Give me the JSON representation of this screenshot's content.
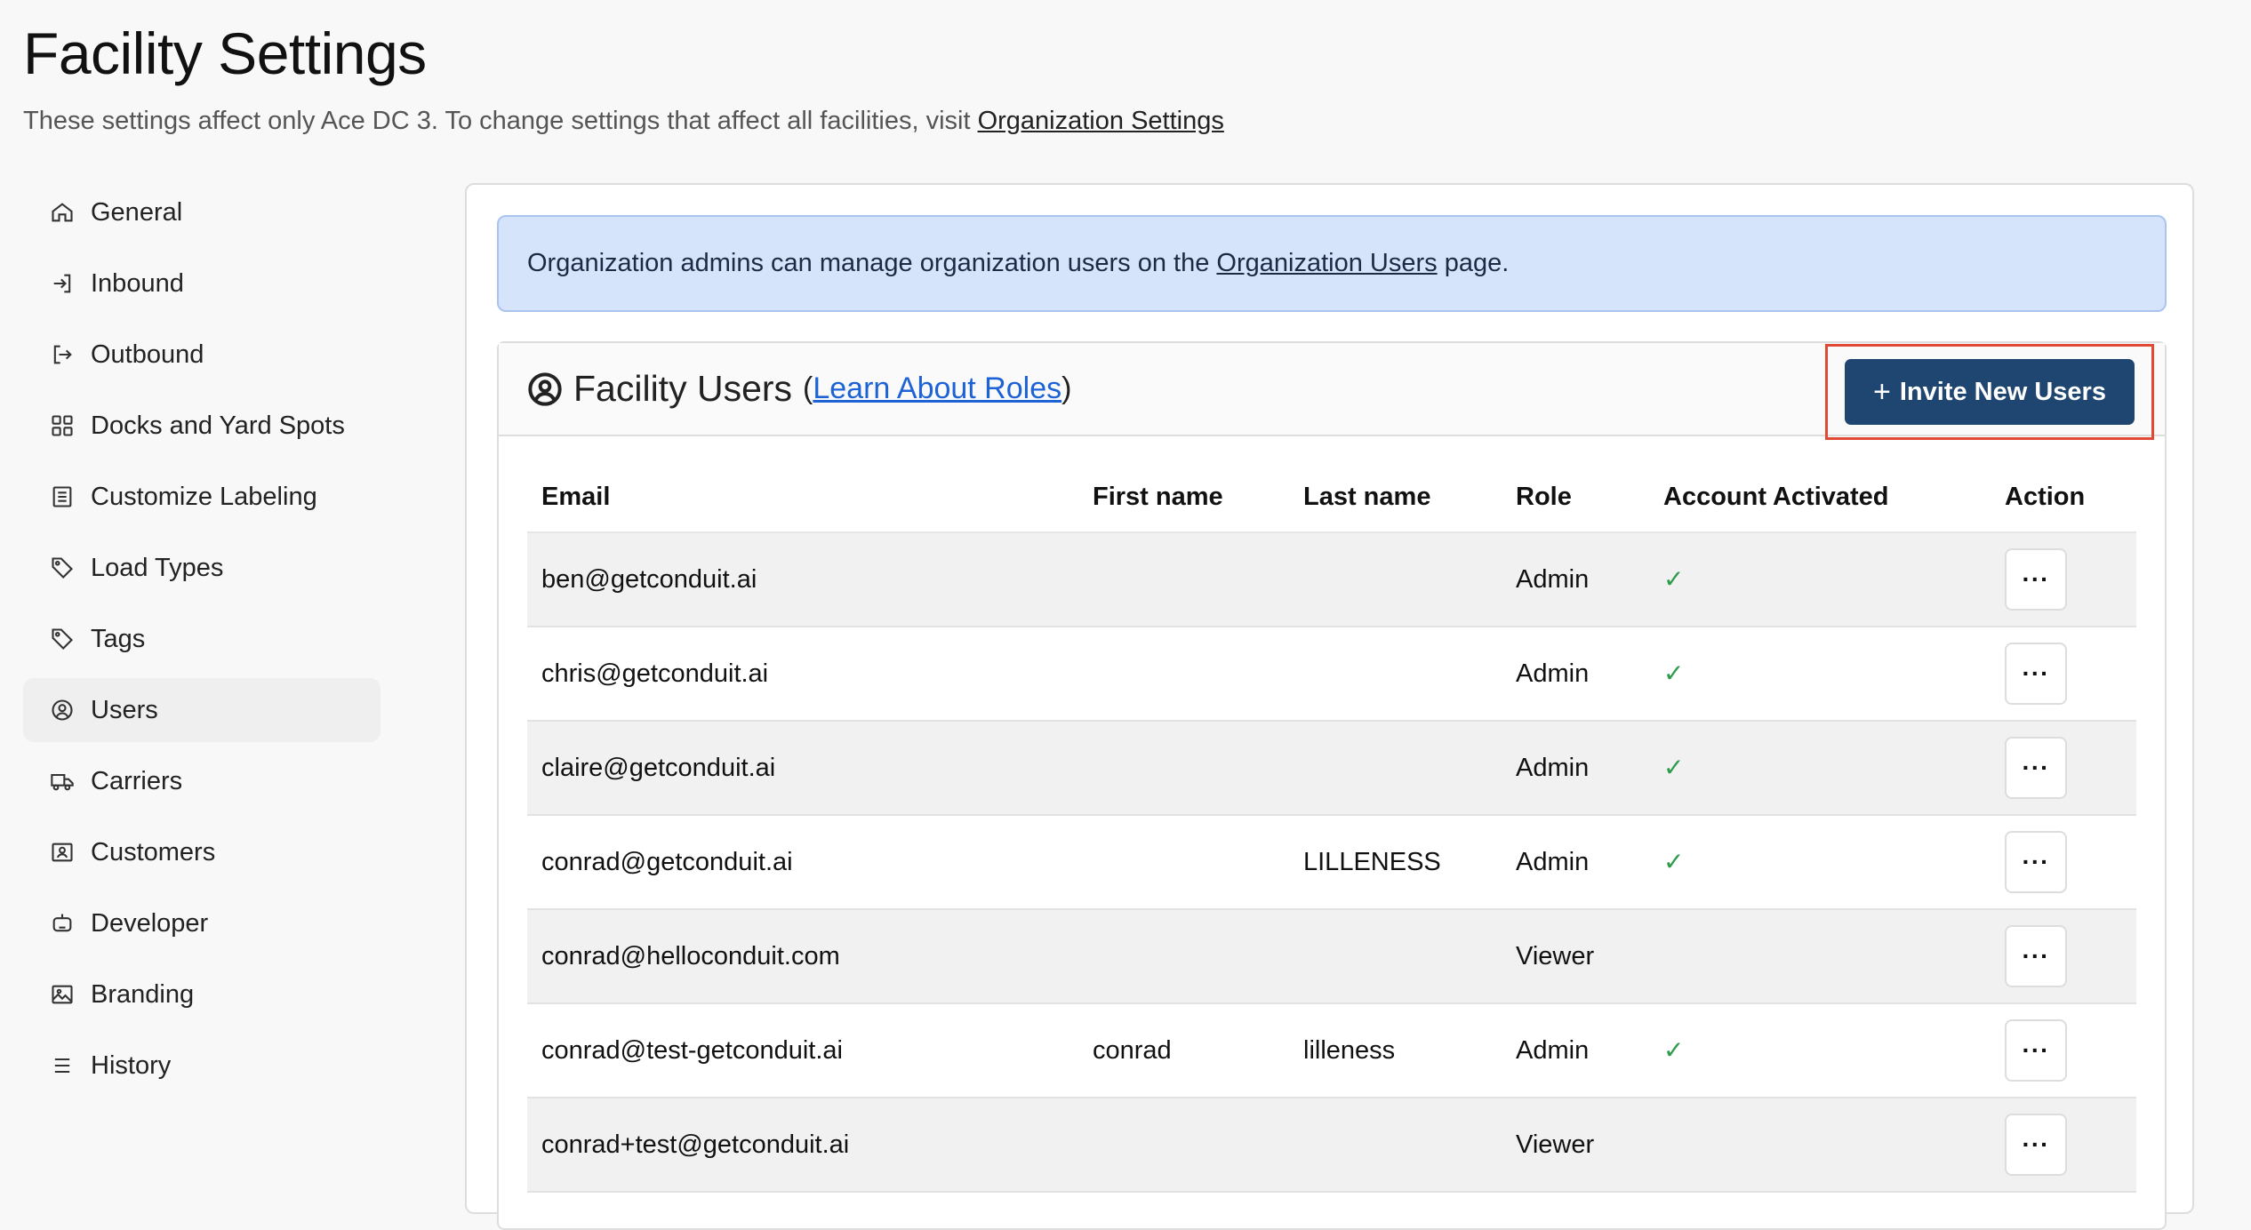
{
  "page": {
    "title": "Facility Settings",
    "subtitle_text": "These settings affect only Ace DC 3. To change settings that affect all facilities, visit ",
    "subtitle_link": "Organization Settings"
  },
  "sidebar": {
    "items": [
      {
        "label": "General",
        "icon": "home-icon"
      },
      {
        "label": "Inbound",
        "icon": "sign-in-icon"
      },
      {
        "label": "Outbound",
        "icon": "sign-out-icon"
      },
      {
        "label": "Docks and Yard Spots",
        "icon": "grid-icon"
      },
      {
        "label": "Customize Labeling",
        "icon": "document-list-icon"
      },
      {
        "label": "Load Types",
        "icon": "tag-icon"
      },
      {
        "label": "Tags",
        "icon": "tag-icon"
      },
      {
        "label": "Users",
        "icon": "user-circle-icon",
        "active": true
      },
      {
        "label": "Carriers",
        "icon": "truck-icon"
      },
      {
        "label": "Customers",
        "icon": "id-card-icon"
      },
      {
        "label": "Developer",
        "icon": "robot-icon"
      },
      {
        "label": "Branding",
        "icon": "image-icon"
      },
      {
        "label": "History",
        "icon": "list-icon"
      }
    ]
  },
  "banner": {
    "text_before": "Organization admins can manage organization users on the ",
    "link": "Organization Users",
    "text_after": " page."
  },
  "users": {
    "title": "Facility Users",
    "paren_open": "(",
    "roles_link": "Learn About Roles",
    "paren_close": ")",
    "invite_label": "Invite New Users",
    "columns": [
      "Email",
      "First name",
      "Last name",
      "Role",
      "Account Activated",
      "Action"
    ],
    "rows": [
      {
        "email": "ben@getconduit.ai",
        "first": "",
        "last": "",
        "role": "Admin",
        "activated": true
      },
      {
        "email": "chris@getconduit.ai",
        "first": "",
        "last": "",
        "role": "Admin",
        "activated": true
      },
      {
        "email": "claire@getconduit.ai",
        "first": "",
        "last": "",
        "role": "Admin",
        "activated": true
      },
      {
        "email": "conrad@getconduit.ai",
        "first": "",
        "last": "LILLENESS",
        "role": "Admin",
        "activated": true
      },
      {
        "email": "conrad@helloconduit.com",
        "first": "",
        "last": "",
        "role": "Viewer",
        "activated": false
      },
      {
        "email": "conrad@test-getconduit.ai",
        "first": "conrad",
        "last": "lilleness",
        "role": "Admin",
        "activated": true
      },
      {
        "email": "conrad+test@getconduit.ai",
        "first": "",
        "last": "",
        "role": "Viewer",
        "activated": false
      }
    ],
    "check_glyph": "✓",
    "action_glyph": "···"
  },
  "colors": {
    "invite_button": "#1f4670",
    "banner_bg": "#d6e4fb",
    "highlight_outline": "#e04a34",
    "check": "#2e9b4b",
    "link": "#1d63d6"
  }
}
